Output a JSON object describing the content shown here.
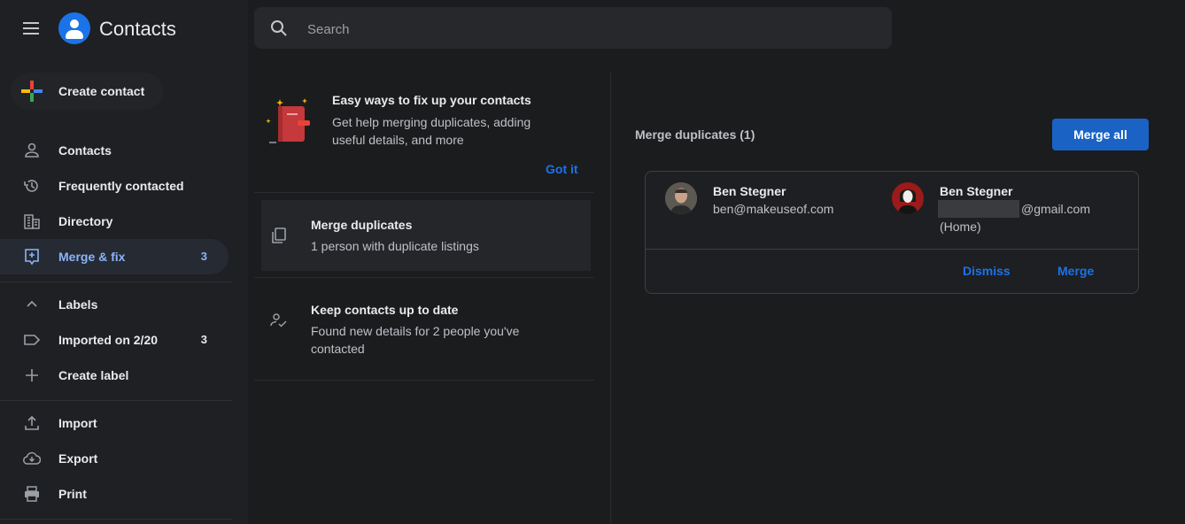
{
  "app": {
    "title": "Contacts"
  },
  "search": {
    "placeholder": "Search"
  },
  "sidebar": {
    "create_contact": "Create contact",
    "nav": [
      {
        "label": "Contacts",
        "icon": "person-icon"
      },
      {
        "label": "Frequently contacted",
        "icon": "history-icon"
      },
      {
        "label": "Directory",
        "icon": "building-icon"
      },
      {
        "label": "Merge & fix",
        "icon": "merge-fix-icon",
        "count": "3",
        "active": true
      }
    ],
    "labels_header": "Labels",
    "labels": [
      {
        "label": "Imported on 2/20",
        "icon": "label-icon",
        "count": "3"
      }
    ],
    "create_label": "Create label",
    "tools": [
      {
        "label": "Import",
        "icon": "upload-icon"
      },
      {
        "label": "Export",
        "icon": "download-cloud-icon"
      },
      {
        "label": "Print",
        "icon": "printer-icon"
      }
    ]
  },
  "tip": {
    "title": "Easy ways to fix up your contacts",
    "desc": "Get help merging duplicates, adding useful details, and more",
    "got_it": "Got it"
  },
  "cards": [
    {
      "title": "Merge duplicates",
      "desc": "1 person with duplicate listings"
    },
    {
      "title": "Keep contacts up to date",
      "desc": "Found new details for 2 people you've contacted"
    }
  ],
  "merge": {
    "header": "Merge duplicates (1)",
    "merge_all": "Merge all",
    "contacts": [
      {
        "name": "Ben Stegner",
        "email": "ben@makeuseof.com"
      },
      {
        "name": "Ben Stegner",
        "email": "@gmail.com",
        "note": "(Home)"
      }
    ],
    "dismiss": "Dismiss",
    "merge": "Merge"
  },
  "colors": {
    "accent": "#1a73e8",
    "background": "#1b1c1e",
    "sidebar_active": "#8ab4f8"
  }
}
